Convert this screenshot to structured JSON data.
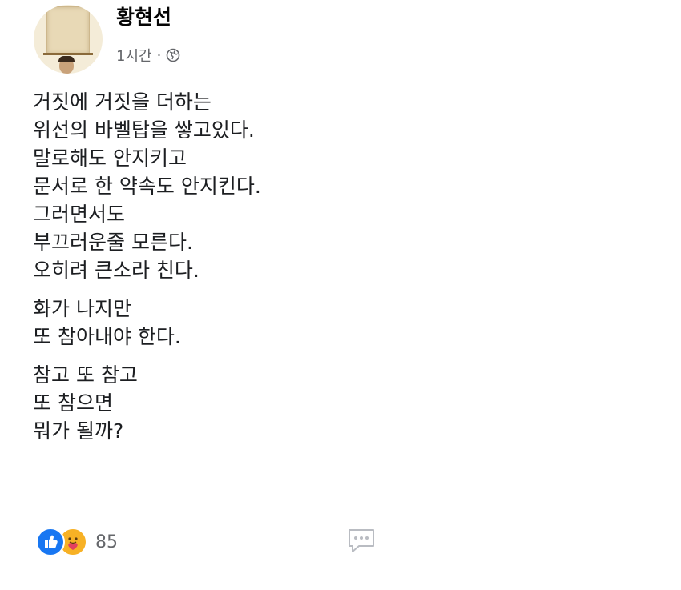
{
  "post": {
    "author": "황현선",
    "time": "1시간",
    "separator": "·",
    "privacy_icon": "globe-icon",
    "paragraphs": [
      {
        "lines": [
          "거짓에 거짓을 더하는",
          "위선의 바벨탑을 쌓고있다.",
          "말로해도 안지키고",
          "문서로 한 약속도 안지킨다.",
          "그러면서도",
          "부끄러운줄 모른다.",
          "오히려 큰소라 친다."
        ]
      },
      {
        "lines": [
          "화가 나지만",
          "또 참아내야 한다."
        ]
      },
      {
        "lines": [
          "참고 또 참고",
          "또 참으면",
          "뭐가 될까?"
        ]
      }
    ],
    "reactions": {
      "icons": [
        "like-icon",
        "care-icon"
      ],
      "count": "85"
    },
    "comment_icon": "comment-icon",
    "colors": {
      "like": "#1877f2",
      "care": "#f7b125",
      "secondary_text": "#65676b",
      "body_text": "#1c1e21"
    }
  }
}
